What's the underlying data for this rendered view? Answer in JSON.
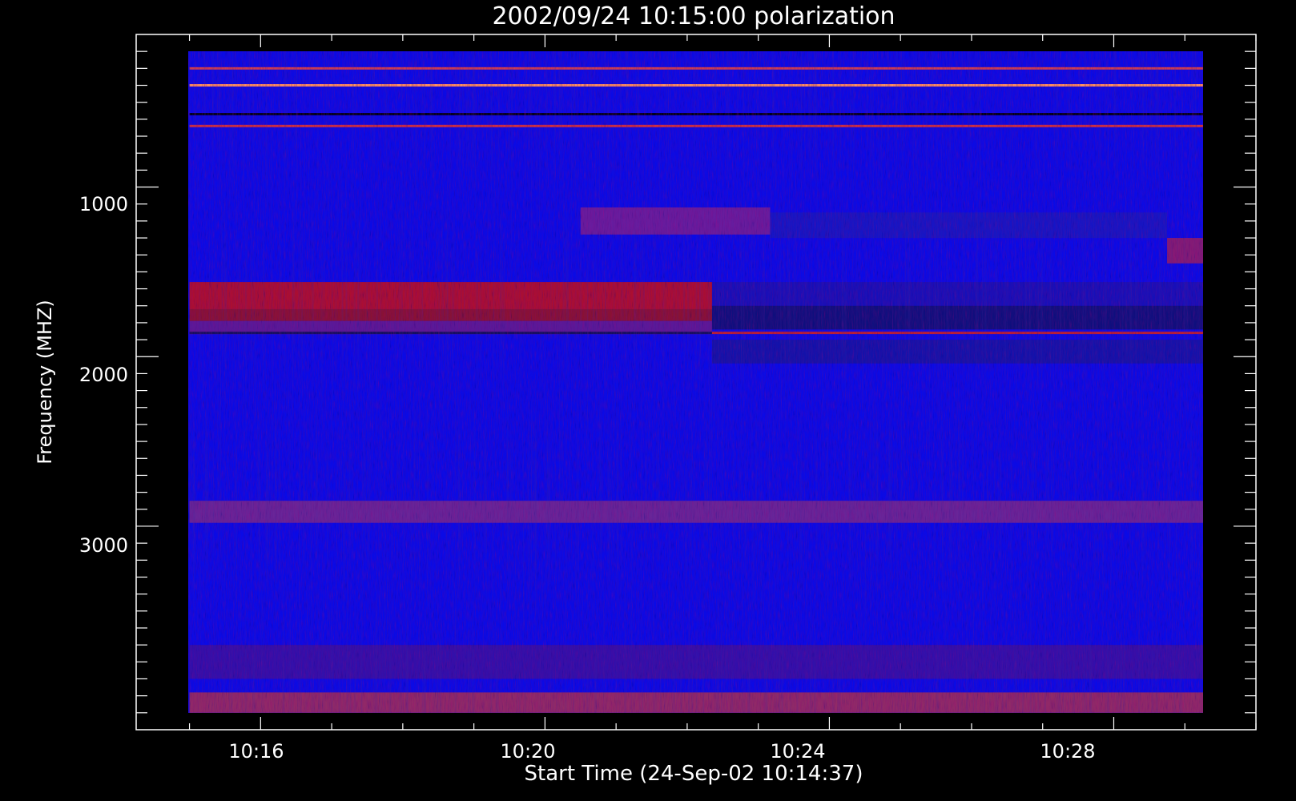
{
  "chart_data": {
    "type": "heatmap",
    "title": "2002/09/24 10:15:00 polarization",
    "xlabel": "Start Time (24-Sep-02 10:14:37)",
    "ylabel": "Frequency (MHZ)",
    "x_start": "10:15:00",
    "x_end": "10:30:00",
    "xlim": [
      "10:14:15",
      "10:30:00"
    ],
    "ylim": [
      4200,
      100
    ],
    "data_extent": {
      "x": [
        "10:15:00",
        "10:30:00"
      ],
      "y": [
        200,
        4100
      ]
    },
    "x_ticks": [
      "10:16",
      "10:20",
      "10:24",
      "10:28"
    ],
    "y_ticks": [
      1000,
      2000,
      3000
    ],
    "colormap": [
      "#000000",
      "#0000ff",
      "#ff0000",
      "#ffffff"
    ],
    "background_color": "#0a0ae6",
    "features": [
      {
        "kind": "band",
        "f1": 1560,
        "f2": 1720,
        "t1": "10:15:00",
        "t2": "10:22:21",
        "color": "#c81010"
      },
      {
        "kind": "band",
        "f1": 1720,
        "f2": 1790,
        "t1": "10:15:00",
        "t2": "10:22:21",
        "color": "#a01414"
      },
      {
        "kind": "band",
        "f1": 1790,
        "f2": 1860,
        "t1": "10:15:00",
        "t2": "10:22:21",
        "color": "#6a1c8a"
      },
      {
        "kind": "band",
        "f1": 1560,
        "f2": 1700,
        "t1": "10:22:21",
        "t2": "10:30:00",
        "color": "#1a10b0"
      },
      {
        "kind": "band",
        "f1": 1700,
        "f2": 1840,
        "t1": "10:22:21",
        "t2": "10:30:00",
        "color": "#10106a"
      },
      {
        "kind": "band",
        "f1": 1900,
        "f2": 2040,
        "t1": "10:22:21",
        "t2": "10:30:00",
        "color": "#1414a0"
      },
      {
        "kind": "band",
        "f1": 1120,
        "f2": 1280,
        "t1": "10:20:30",
        "t2": "10:23:10",
        "color": "#7a2090"
      },
      {
        "kind": "band",
        "f1": 1150,
        "f2": 1300,
        "t1": "10:23:10",
        "t2": "10:28:45",
        "color": "#1818c0"
      },
      {
        "kind": "band",
        "f1": 1300,
        "f2": 1450,
        "t1": "10:28:45",
        "t2": "10:30:00",
        "color": "#9a2060"
      },
      {
        "kind": "band",
        "f1": 2850,
        "f2": 2980,
        "t1": "10:15:00",
        "t2": "10:30:00",
        "color": "#7a2a8a"
      },
      {
        "kind": "band",
        "f1": 3700,
        "f2": 3900,
        "t1": "10:15:00",
        "t2": "10:30:00",
        "color": "#3a10a0"
      },
      {
        "kind": "band",
        "f1": 3980,
        "f2": 4100,
        "t1": "10:15:00",
        "t2": "10:30:00",
        "color": "#a83050"
      },
      {
        "kind": "line",
        "f": 1860,
        "t1": "10:15:00",
        "t2": "10:30:00",
        "color": "#c02030"
      },
      {
        "kind": "line",
        "f": 1860,
        "t1": "10:15:00",
        "t2": "10:22:21",
        "color": "#101060"
      },
      {
        "kind": "line",
        "f": 570,
        "t1": "10:15:00",
        "t2": "10:30:00",
        "color": "#000020"
      },
      {
        "kind": "line",
        "f": 300,
        "t1": "10:15:00",
        "t2": "10:30:00",
        "color": "#d04050"
      },
      {
        "kind": "line",
        "f": 400,
        "t1": "10:15:00",
        "t2": "10:30:00",
        "color": "#ff9060"
      },
      {
        "kind": "line",
        "f": 640,
        "t1": "10:15:00",
        "t2": "10:30:00",
        "color": "#d03040"
      }
    ]
  }
}
